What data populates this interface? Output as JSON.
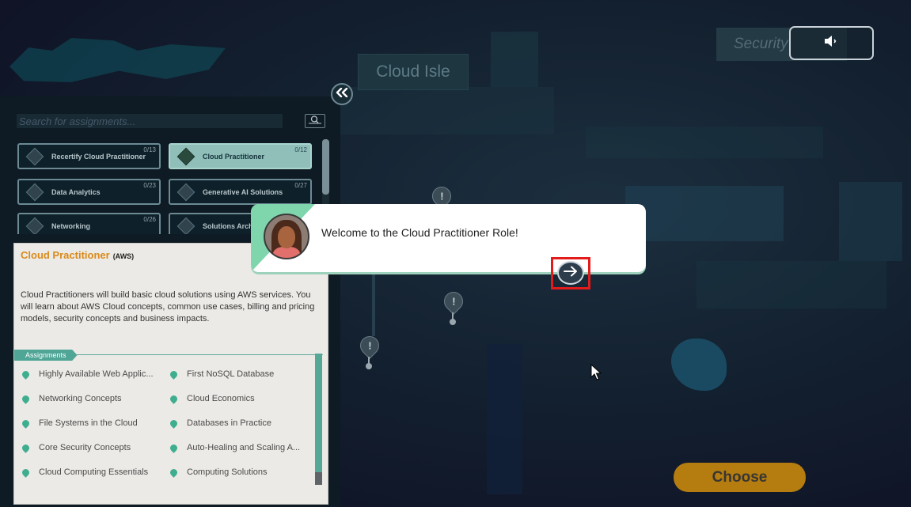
{
  "map": {
    "cloud_isle_label": "Cloud Isle",
    "security_label": "Security",
    "sound_icon": "speaker-icon"
  },
  "left_panel": {
    "collapse_icon": "double-chevron-left-icon",
    "search": {
      "placeholder": "Search for assignments...",
      "value": "",
      "icon": "search-icon"
    },
    "roles": [
      {
        "name": "Recertify Cloud Practitioner",
        "count": "0/13",
        "selected": false
      },
      {
        "name": "Cloud Practitioner",
        "count": "0/12",
        "selected": true
      },
      {
        "name": "Data Analytics",
        "count": "0/23",
        "selected": false
      },
      {
        "name": "Generative AI Solutions",
        "count": "0/27",
        "selected": false
      },
      {
        "name": "Networking",
        "count": "0/26",
        "selected": false
      },
      {
        "name": "Solutions Architect",
        "count": "",
        "selected": false
      }
    ],
    "detail": {
      "title": "Cloud Practitioner",
      "tag": "(AWS)",
      "description": "Cloud Practitioners will build basic cloud solutions using AWS services. You will learn about AWS Cloud concepts, common use cases, billing and pricing models, security concepts and business impacts.",
      "assignments_label": "Assignments",
      "assignments": [
        "Highly Available Web Applic...",
        "First NoSQL Database",
        "Networking Concepts",
        "Cloud Economics",
        "File Systems in the Cloud",
        "Databases in Practice",
        "Core Security Concepts",
        "Auto-Healing and Scaling A...",
        "Cloud Computing Essentials",
        "Computing Solutions"
      ]
    }
  },
  "dialog": {
    "message": "Welcome to the Cloud Practitioner Role!",
    "next_icon": "arrow-right-icon"
  },
  "choose_button": {
    "label": "Choose"
  },
  "colors": {
    "accent_orange": "#d98a1c",
    "accent_green": "#4fa596",
    "highlight_red": "#e21b1b"
  }
}
